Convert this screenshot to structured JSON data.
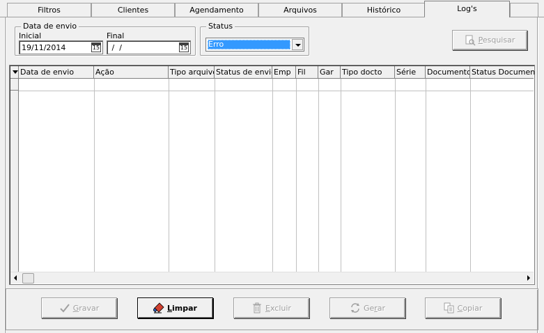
{
  "tabs": [
    "Filtros",
    "Clientes",
    "Agendamento",
    "Arquivos",
    "Histórico",
    "Log's"
  ],
  "active_tab": "Log's",
  "data_envio_group": {
    "legend": "Data de envio",
    "inicial_label": "Inicial",
    "inicial_value": "19/11/2014",
    "final_label": "Final",
    "final_value": " /  / ",
    "calendar_glyph": "15"
  },
  "status_group": {
    "legend": "Status",
    "selected": "Erro"
  },
  "pesquisar_button": {
    "prefix": "",
    "hotkey": "P",
    "rest": "esquisar",
    "icon": "search-document-icon",
    "enabled": false
  },
  "grid": {
    "columns": [
      "Data de envio",
      "Ação",
      "Tipo arquivo",
      "Status de envio",
      "Emp",
      "Fil",
      "Gar",
      "Tipo docto",
      "Série",
      "Documento",
      "Status Documento"
    ],
    "rows": []
  },
  "buttons": {
    "gravar": {
      "hotkey": "G",
      "rest": "ravar",
      "icon": "check-icon",
      "enabled": false
    },
    "limpar": {
      "hotkey": "L",
      "rest": "impar",
      "icon": "eraser-icon",
      "enabled": true
    },
    "excluir": {
      "hotkey": "E",
      "rest": "xcluir",
      "icon": "trash-icon",
      "enabled": false
    },
    "gerar": {
      "prefix": "Ge",
      "hotkey": "r",
      "rest": "ar",
      "icon": "refresh-icon",
      "enabled": false
    },
    "copiar": {
      "hotkey": "C",
      "rest": "opiar",
      "icon": "copy-icon",
      "enabled": false
    }
  },
  "colors": {
    "selection": "#3399ff",
    "face": "#f0f0f0",
    "shadow": "#a0a0a0"
  }
}
